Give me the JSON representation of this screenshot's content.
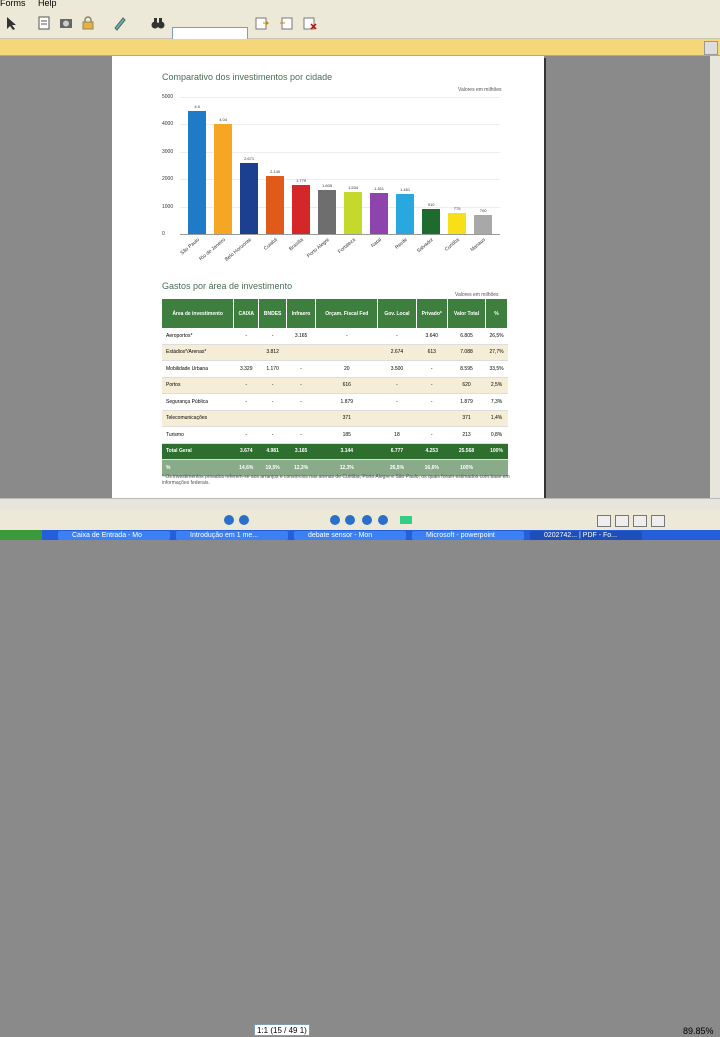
{
  "menu": {
    "forms": "Forms",
    "help": "Help"
  },
  "chart_title": "Comparativo dos investimentos por cidade",
  "chart_note": "Valores em milhões",
  "chart_data": {
    "type": "bar",
    "title": "Comparativo dos investimentos por cidade",
    "categories": [
      "São Paulo",
      "Rio de Janeiro",
      "Belo Horizonte",
      "Cuiabá",
      "Brasília",
      "Porto Alegre",
      "Fortaleza",
      "Natal",
      "Recife",
      "Salvador",
      "Curitiba",
      "Manaus"
    ],
    "values": [
      4500,
      4000,
      2600,
      2100,
      1800,
      1600,
      1550,
      1500,
      1450,
      900,
      750,
      700
    ],
    "value_labels": [
      "4.5",
      "4.04",
      "2.671",
      "2.140",
      "1.779",
      "1.605",
      "1.534",
      "1.511",
      "1.451",
      "910",
      "775",
      "700"
    ],
    "ylim": [
      0,
      5000
    ],
    "yticks": [
      "5000",
      "4000",
      "3000",
      "2000",
      "1000",
      "0"
    ],
    "colors": [
      "#1f7ac7",
      "#f5a623",
      "#1c3f8f",
      "#e05a1a",
      "#d62728",
      "#6e6e6e",
      "#c5d92d",
      "#8e44ad",
      "#29a8e0",
      "#1e6b2e",
      "#f7e017",
      "#a8a8a8"
    ]
  },
  "table_title": "Gastos por área de investimento",
  "table_note": "Valores em milhões",
  "table": {
    "headers": [
      "Área de investimento",
      "CAIXA",
      "BNDES",
      "Infraero",
      "Orçam. Fiscal Fed",
      "Gov. Local",
      "Privado*",
      "Valor Total",
      "%"
    ],
    "rows": [
      [
        "Aeroportos*",
        "-",
        "-",
        "3.165",
        "-",
        "-",
        "3.640",
        "6.805",
        "26,5%"
      ],
      [
        "Estádios*/Arenas*",
        "",
        "3.812",
        "",
        "",
        "2.674",
        "613",
        "7.088",
        "27,7%"
      ],
      [
        "Mobilidade Urbana",
        "3.329",
        "1.170",
        "-",
        "20",
        "3.500",
        "-",
        "8.595",
        "33,5%"
      ],
      [
        "Portos",
        "-",
        "-",
        "-",
        "616",
        "-",
        "-",
        "620",
        "2,5%"
      ],
      [
        "Segurança Pública",
        "-",
        "-",
        "-",
        "1.879",
        "-",
        "-",
        "1.879",
        "7,3%"
      ],
      [
        "Telecomunicações",
        "",
        "",
        "",
        "371",
        "",
        "",
        "371",
        "1,4%"
      ],
      [
        "Turismo",
        "-",
        "-",
        "-",
        "185",
        "18",
        "-",
        "213",
        "0,8%"
      ]
    ],
    "total": [
      "Total Geral",
      "3.674",
      "4.981",
      "3.165",
      "3.144",
      "6.777",
      "4.253",
      "25.568",
      "100%"
    ],
    "pct": [
      "%",
      "14,6%",
      "19,5%",
      "12,3%",
      "12,3%",
      "26,5%",
      "16,6%",
      "100%",
      ""
    ]
  },
  "footnote": "* Os investimentos privados referem-se aos arranjos e consórcios nas arenas de Curitiba, Porto Alegre e São Paulo, os quais foram estimados com base em informações federais.",
  "nav": {
    "page_value": "1:1 (15 / 49 1)",
    "zoom": "89.85%"
  },
  "taskbar": {
    "tasks": [
      "Caixa de Entrada - Mo",
      "Introdução em 1 me...",
      "debate sensor - Mon",
      "Microsoft - powerpoint",
      "0202742... | PDF - Fo..."
    ]
  }
}
